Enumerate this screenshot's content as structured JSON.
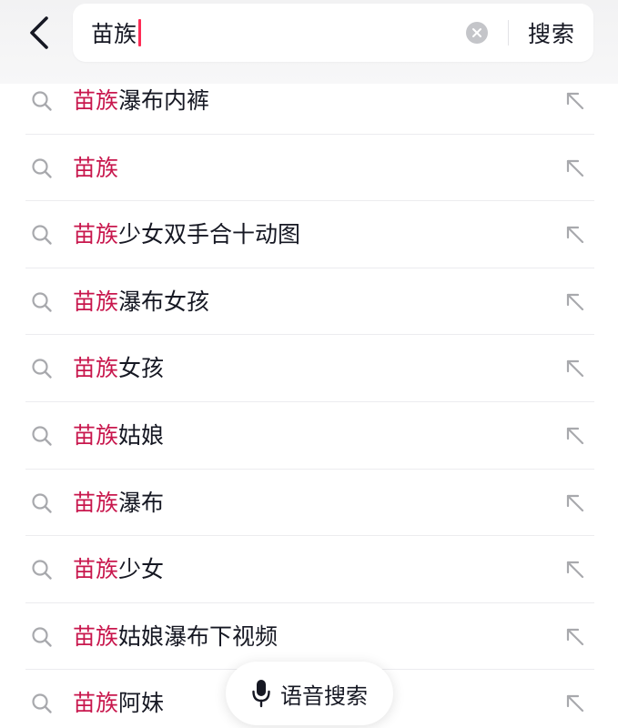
{
  "search": {
    "query": "苗族",
    "submit_label": "搜索"
  },
  "suggestions": [
    {
      "highlight": "苗族",
      "rest": "瀑布内裤"
    },
    {
      "highlight": "苗族",
      "rest": ""
    },
    {
      "highlight": "苗族",
      "rest": "少女双手合十动图"
    },
    {
      "highlight": "苗族",
      "rest": "瀑布女孩"
    },
    {
      "highlight": "苗族",
      "rest": "女孩"
    },
    {
      "highlight": "苗族",
      "rest": "姑娘"
    },
    {
      "highlight": "苗族",
      "rest": "瀑布"
    },
    {
      "highlight": "苗族",
      "rest": "少女"
    },
    {
      "highlight": "苗族",
      "rest": "姑娘瀑布下视频"
    },
    {
      "highlight": "苗族",
      "rest": "阿妹"
    }
  ],
  "voice": {
    "label": "语音搜索"
  },
  "icons": {
    "back": "chevron-left-icon",
    "clear": "clear-circle-icon",
    "suggest": "search-icon",
    "fill": "arrow-up-left-icon",
    "voice": "microphone-icon"
  },
  "colors": {
    "highlight": "#c8174d",
    "caret": "#fe2c55",
    "text": "#161823",
    "icon": "#a8a9ad"
  }
}
